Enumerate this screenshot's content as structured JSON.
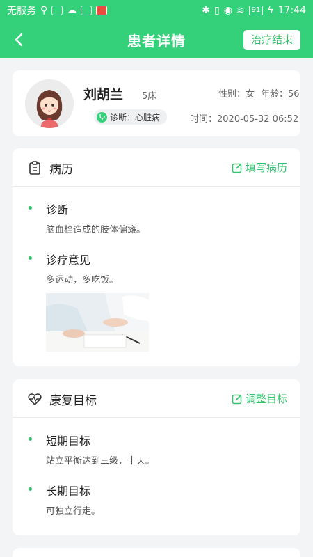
{
  "status_bar": {
    "carrier": "无服务",
    "battery": "91",
    "time": "17:44"
  },
  "header": {
    "title": "患者详情",
    "end_button": "治疗结束"
  },
  "patient": {
    "name": "刘胡兰",
    "bed": "5床",
    "gender": "性别：女",
    "age": "年龄：56",
    "diagnosis": "诊断：心脏病",
    "time": "时间：2020-05-32 06:52"
  },
  "medical_history": {
    "title": "病历",
    "action": "填写病历",
    "items": [
      {
        "title": "诊断",
        "text": "脑血栓造成的肢体偏瘫。"
      },
      {
        "title": "诊疗意见",
        "text": "多运动，多吃饭。"
      }
    ]
  },
  "rehab_goals": {
    "title": "康复目标",
    "action": "调整目标",
    "items": [
      {
        "title": "短期目标",
        "text": "站立平衡达到三级，十天。"
      },
      {
        "title": "长期目标",
        "text": "可独立行走。"
      }
    ]
  },
  "colors": {
    "primary": "#35d07a",
    "background": "#f3f4f6"
  }
}
